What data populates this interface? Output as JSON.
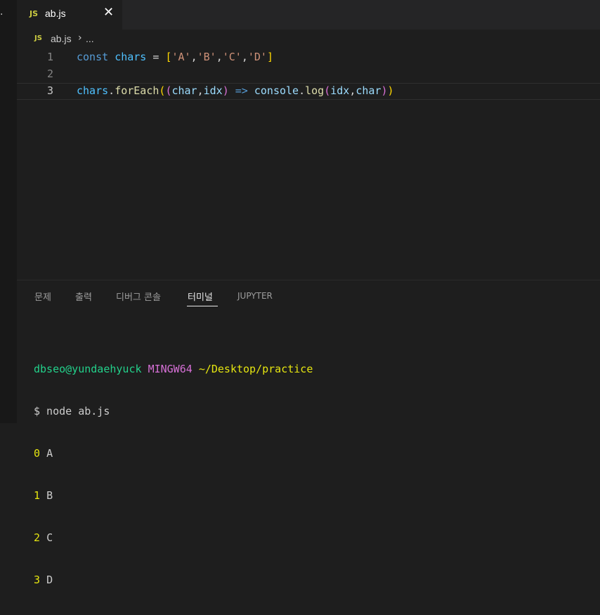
{
  "colors": {
    "background": "#1e1e1e",
    "tabbar_background": "#252526",
    "js_badge": "#cbcb41",
    "terminal_user": "#23d18b",
    "terminal_system": "#d670d6",
    "terminal_path": "#e5e510"
  },
  "left_strip": {
    "glyph": "·"
  },
  "tab": {
    "badge": "JS",
    "title": "ab.js",
    "close_glyph": "✕",
    "icon": "close-icon"
  },
  "breadcrumb": {
    "badge": "JS",
    "file": "ab.js",
    "separator": "›",
    "ellipsis": "..."
  },
  "editor": {
    "lines": [
      {
        "number": "1",
        "tokens": [
          {
            "t": "const",
            "c": "kw"
          },
          {
            "t": " ",
            "c": "op"
          },
          {
            "t": "chars",
            "c": "var"
          },
          {
            "t": " = ",
            "c": "op"
          },
          {
            "t": "[",
            "c": "br1"
          },
          {
            "t": "'A'",
            "c": "str"
          },
          {
            "t": ",",
            "c": "op"
          },
          {
            "t": "'B'",
            "c": "str"
          },
          {
            "t": ",",
            "c": "op"
          },
          {
            "t": "'C'",
            "c": "str"
          },
          {
            "t": ",",
            "c": "op"
          },
          {
            "t": "'D'",
            "c": "str"
          },
          {
            "t": "]",
            "c": "br1"
          }
        ]
      },
      {
        "number": "2",
        "tokens": []
      },
      {
        "number": "3",
        "current": true,
        "tokens": [
          {
            "t": "chars",
            "c": "var"
          },
          {
            "t": ".",
            "c": "op"
          },
          {
            "t": "forEach",
            "c": "fn"
          },
          {
            "t": "(",
            "c": "br1"
          },
          {
            "t": "(",
            "c": "br2"
          },
          {
            "t": "char",
            "c": "param"
          },
          {
            "t": ",",
            "c": "op"
          },
          {
            "t": "idx",
            "c": "param"
          },
          {
            "t": ")",
            "c": "br2"
          },
          {
            "t": " ",
            "c": "op"
          },
          {
            "t": "=>",
            "c": "arrow"
          },
          {
            "t": " ",
            "c": "op"
          },
          {
            "t": "console",
            "c": "param"
          },
          {
            "t": ".",
            "c": "op"
          },
          {
            "t": "log",
            "c": "fn"
          },
          {
            "t": "(",
            "c": "br2"
          },
          {
            "t": "idx",
            "c": "param"
          },
          {
            "t": ",",
            "c": "op"
          },
          {
            "t": "char",
            "c": "param"
          },
          {
            "t": ")",
            "c": "br2"
          },
          {
            "t": ")",
            "c": "br1"
          }
        ]
      }
    ]
  },
  "panel": {
    "tabs": [
      {
        "label": "문제"
      },
      {
        "label": "출력"
      },
      {
        "label": "디버그 콘솔"
      },
      {
        "label": "터미널",
        "active": true
      },
      {
        "label": "JUPYTER"
      }
    ]
  },
  "terminal": {
    "prompt_user": "dbseo@yundaehyuck",
    "prompt_system": "MINGW64",
    "prompt_path": "~/Desktop/practice",
    "command_line": "$ node ab.js",
    "output": [
      {
        "index": "0",
        "value": "A"
      },
      {
        "index": "1",
        "value": "B"
      },
      {
        "index": "2",
        "value": "C"
      },
      {
        "index": "3",
        "value": "D"
      }
    ]
  }
}
